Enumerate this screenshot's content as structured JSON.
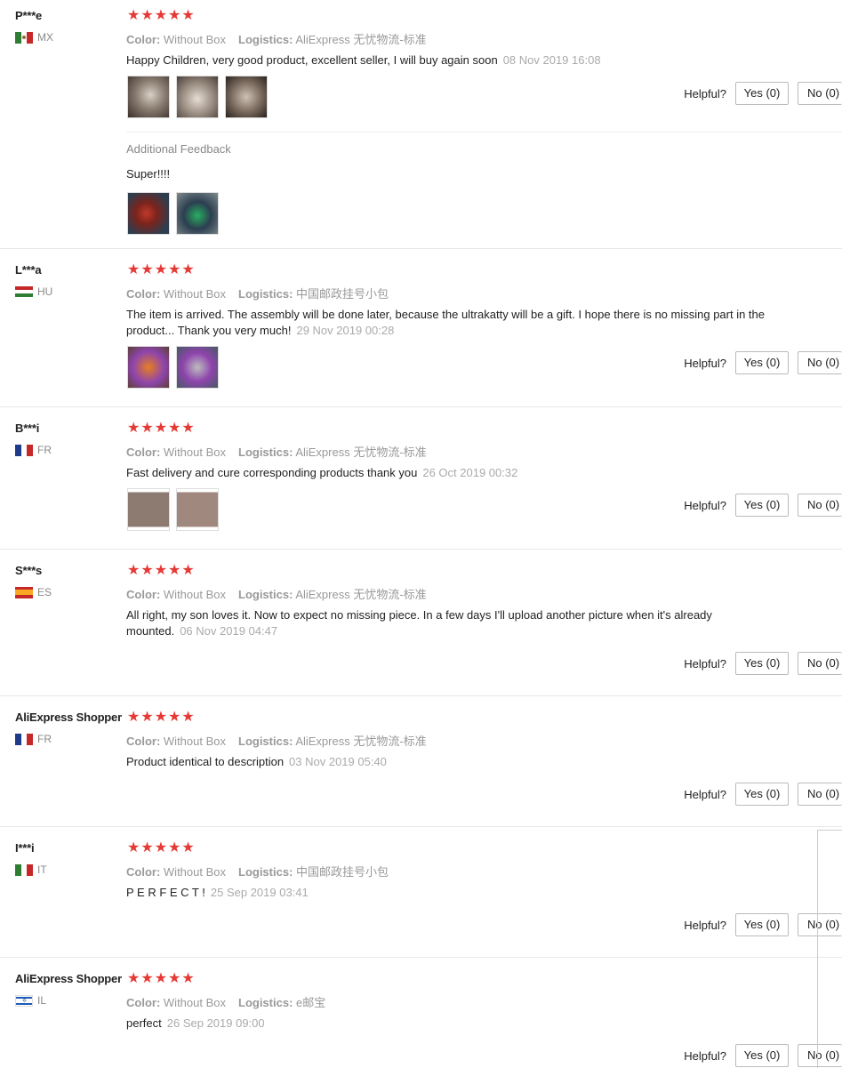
{
  "helpful_label": "Helpful?",
  "color_key": "Color:",
  "logistics_key": "Logistics:",
  "colors": {
    "star": "#e53935",
    "muted": "#999999",
    "border": "#e8e8e8"
  },
  "reviews": [
    {
      "name": "P***e",
      "country": "MX",
      "flag": "mexico-flag",
      "stars": "★★★★★",
      "rating": 5,
      "color": "Without Box",
      "logistics": "AliExpress 无忧物流-标准",
      "text": "Happy Children, very good product, excellent seller, I will buy again soon",
      "date": "08 Nov 2019 16:08",
      "yes": "Yes (0)",
      "no": "No (0)",
      "photos": 3,
      "additional_feedback": {
        "title": "Additional Feedback",
        "text": "Super!!!!",
        "photos": 2
      }
    },
    {
      "name": "L***a",
      "country": "HU",
      "flag": "hungary-flag",
      "stars": "★★★★★",
      "rating": 5,
      "color": "Without Box",
      "logistics": "中国邮政挂号小包",
      "text": "The item is arrived. The assembly will be done later, because the ultrakatty will be a gift. I hope there is no missing part in the product... Thank you very much!",
      "date": "29 Nov 2019 00:28",
      "yes": "Yes (0)",
      "no": "No (0)",
      "photos": 2
    },
    {
      "name": "B***i",
      "country": "FR",
      "flag": "france-flag",
      "stars": "★★★★★",
      "rating": 5,
      "color": "Without Box",
      "logistics": "AliExpress 无忧物流-标准",
      "text": "Fast delivery and cure corresponding products thank you",
      "date": "26 Oct 2019 00:32",
      "yes": "Yes (0)",
      "no": "No (0)",
      "photos": 2
    },
    {
      "name": "S***s",
      "country": "ES",
      "flag": "spain-flag",
      "stars": "★★★★★",
      "rating": 5,
      "color": "Without Box",
      "logistics": "AliExpress 无忧物流-标准",
      "text": "All right, my son loves it. Now to expect no missing piece. In a few days I'll upload another picture when it's already mounted.",
      "date": "06 Nov 2019 04:47",
      "yes": "Yes (0)",
      "no": "No (0)",
      "photos": 0
    },
    {
      "name": "AliExpress Shopper",
      "country": "FR",
      "flag": "france-flag",
      "stars": "★★★★★",
      "rating": 5,
      "color": "Without Box",
      "logistics": "AliExpress 无忧物流-标准",
      "text": "Product identical to description",
      "date": "03 Nov 2019 05:40",
      "yes": "Yes (0)",
      "no": "No (0)",
      "photos": 0
    },
    {
      "name": "I***i",
      "country": "IT",
      "flag": "italy-flag",
      "stars": "★★★★★",
      "rating": 5,
      "color": "Without Box",
      "logistics": "中国邮政挂号小包",
      "text": "P E R F E C T !",
      "date": "25 Sep 2019 03:41",
      "yes": "Yes (0)",
      "no": "No (0)",
      "photos": 0
    },
    {
      "name": "AliExpress Shopper",
      "country": "IL",
      "flag": "israel-flag",
      "stars": "★★★★★",
      "rating": 5,
      "color": "Without Box",
      "logistics": "e邮宝",
      "text": "perfect",
      "date": "26 Sep 2019 09:00",
      "yes": "Yes (0)",
      "no": "No (0)",
      "photos": 0
    }
  ]
}
